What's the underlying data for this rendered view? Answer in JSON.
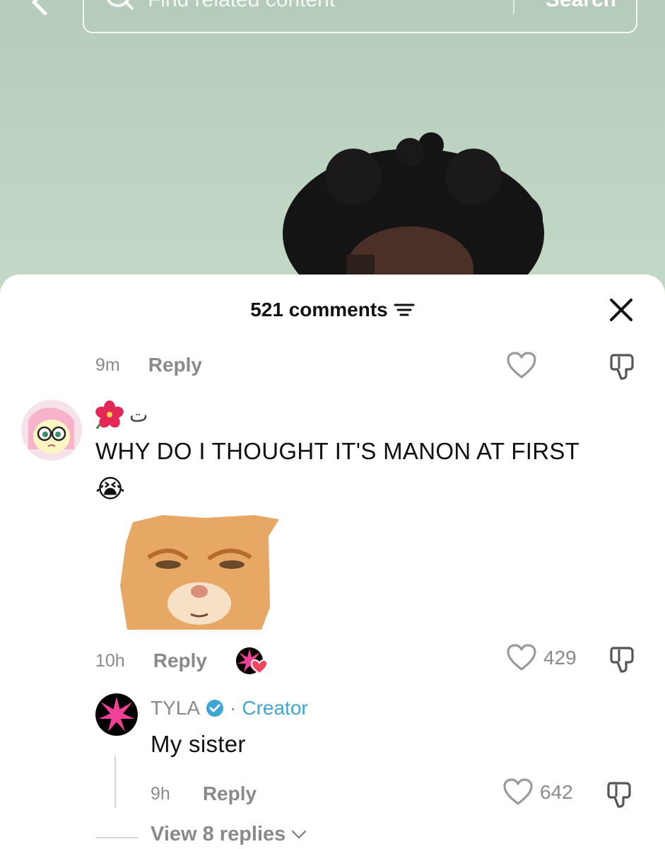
{
  "search": {
    "placeholder": "Find related content",
    "button_label": "Search"
  },
  "sheet": {
    "comments_count": "521 comments"
  },
  "first_meta": {
    "time": "9m",
    "reply_label": "Reply"
  },
  "comment": {
    "username": "ت",
    "text": "WHY DO I THOUGHT IT'S MANON AT FIRST",
    "emoji": "😭",
    "time": "10h",
    "reply_label": "Reply",
    "like_count": "429"
  },
  "reply": {
    "username": "TYLA",
    "separator": "·",
    "creator_label": "Creator",
    "text": "My sister",
    "time": "9h",
    "reply_label": "Reply",
    "like_count": "642"
  },
  "view_replies": "View 8 replies",
  "colors": {
    "creator": "#3fa6d4",
    "heart_badge": "#f0445f",
    "star": "#f23f97"
  },
  "icons": [
    "back-arrow-icon",
    "search-icon",
    "filter-icon",
    "close-icon",
    "heart-icon",
    "dislike-icon",
    "hibiscus-icon",
    "verified-icon",
    "chevron-down-icon"
  ]
}
